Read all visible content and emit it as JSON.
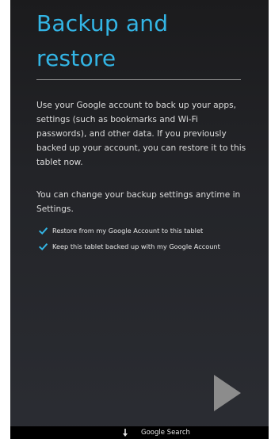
{
  "page": {
    "title_line1": "Backup and",
    "title_line2": "restore",
    "paragraph1": "Use your Google account to back up your apps, settings (such as bookmarks and Wi-Fi passwords), and other data. If you previously backed up your account, you can restore it to this tablet now.",
    "paragraph2": "You can change your backup settings anytime in Settings."
  },
  "options": [
    {
      "label": "Restore from my Google Account to this tablet",
      "checked": true
    },
    {
      "label": "Keep this tablet backed up with my Google Account",
      "checked": true
    }
  ],
  "next_button": {
    "icon": "play-arrow-icon"
  },
  "navbar": {
    "label": "Google Search",
    "icon": "down-arrow-icon"
  },
  "colors": {
    "accent": "#33b5e5",
    "checkbox": "#33b5e5",
    "next_arrow": "#8c8c8c",
    "background_top": "#1b1b1d",
    "background_bottom": "#2b2d33"
  }
}
